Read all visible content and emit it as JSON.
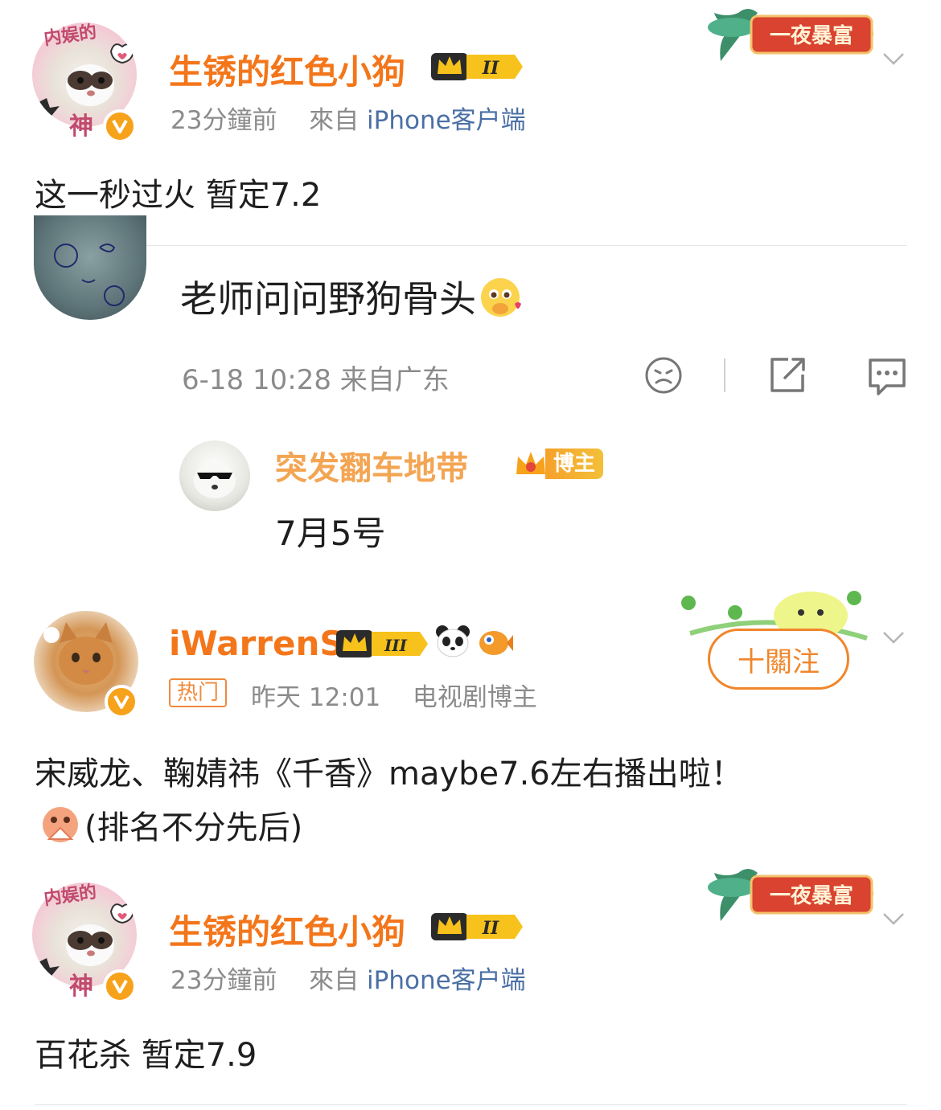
{
  "posts": [
    {
      "username": "生锈的红色小狗",
      "avatar_text_top": "内娱的",
      "avatar_text_bottom": "神",
      "time": "23分鐘前",
      "source_prefix": "來自",
      "source": "iPhone客户端",
      "rank": "II",
      "banner": "一夜暴富",
      "text": "这一秒过火 暂定7.2"
    },
    {
      "username": "iWarrenS",
      "tag": "热门",
      "time": "昨天 12:01",
      "source": "电视剧博主",
      "rank": "III",
      "text_line1": "宋威龙、鞠婧祎《千香》maybe7.6左右播出啦！",
      "text_line2": "(排名不分先后)",
      "follow_label": "十關注"
    },
    {
      "username": "生锈的红色小狗",
      "avatar_text_top": "内娱的",
      "avatar_text_bottom": "神",
      "time": "23分鐘前",
      "source_prefix": "來自",
      "source": "iPhone客户端",
      "rank": "II",
      "banner": "一夜暴富",
      "text": "百花杀 暂定7.9"
    }
  ],
  "comment": {
    "text": "老师问问野狗骨头",
    "meta": "6-18 10:28 来自广东",
    "reply": {
      "username": "突发翻车地带",
      "badge": "博主",
      "text": "7月5号"
    }
  },
  "icons": [
    "chevron-down-icon",
    "dislike-icon",
    "share-icon",
    "comment-icon",
    "crown-icon",
    "panda-icon",
    "fish-icon",
    "v-badge-icon"
  ],
  "colors": {
    "username": "#f3761b",
    "meta": "#8b8b8b",
    "source_link": "#4a6fa5",
    "follow": "#f0862b",
    "vip_gold": "#f7c21b",
    "banner_red": "#d9432f"
  }
}
